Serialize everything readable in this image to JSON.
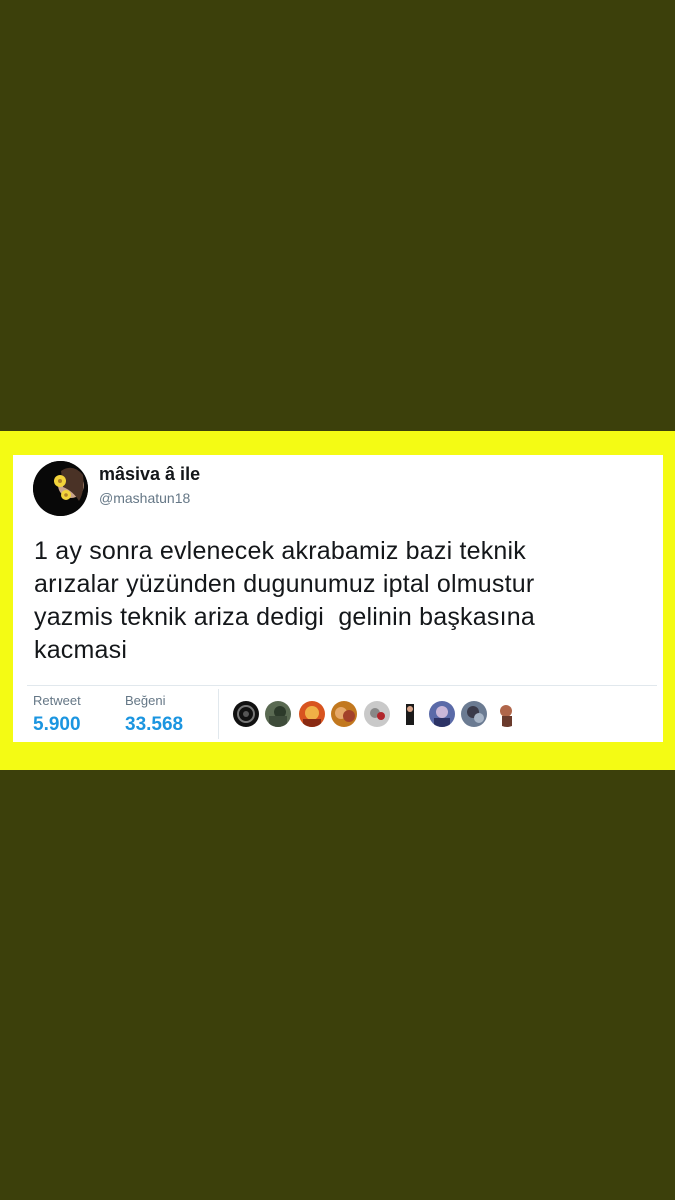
{
  "tweet": {
    "display_name": "mâsiva â ile",
    "handle": "@mashatun18",
    "text": "1 ay sonra evlenecek akrabamiz bazi teknik\narızalar yüzünden dugunumuz iptal olmustur\nyazmis teknik ariza dedigi  gelinin başkasına\nkacmasi",
    "stats": {
      "retweet_label": "Retweet",
      "retweet_count": "5.900",
      "like_label": "Beğeni",
      "like_count": "33.568"
    }
  },
  "colors": {
    "background": "#3c400b",
    "band": "#f4fb14",
    "card": "#ffffff",
    "stat_value": "#1b95e0",
    "secondary_text": "#657786"
  },
  "liker_avatars": [
    "liker-avatar-1",
    "liker-avatar-2",
    "liker-avatar-3",
    "liker-avatar-4",
    "liker-avatar-5",
    "liker-avatar-6",
    "liker-avatar-7",
    "liker-avatar-8",
    "liker-avatar-9",
    "liker-avatar-10"
  ]
}
